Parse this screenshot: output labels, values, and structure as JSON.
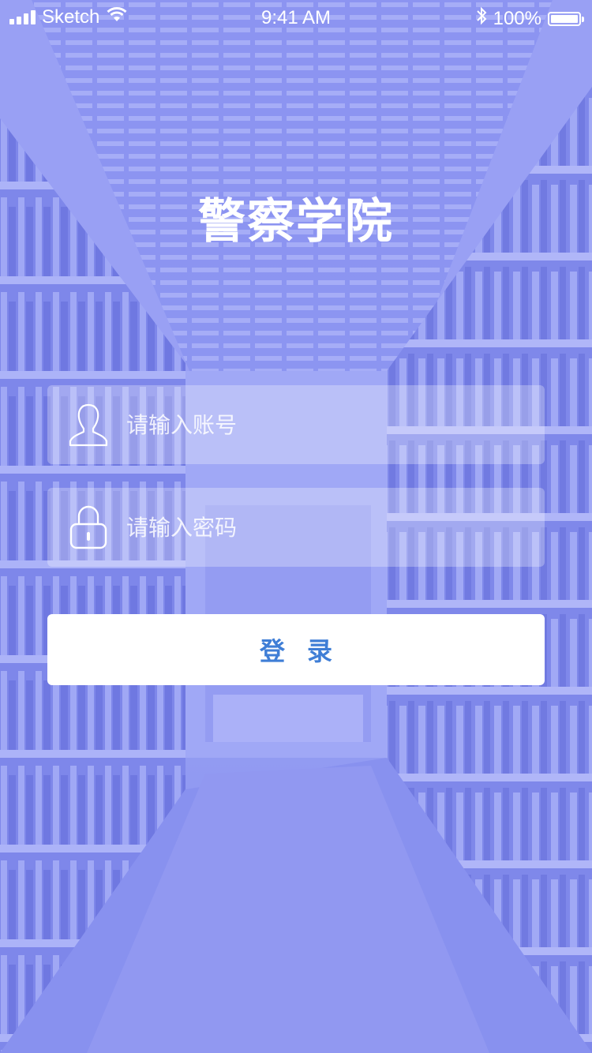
{
  "status_bar": {
    "carrier": "Sketch",
    "time": "9:41 AM",
    "battery_label": "100%",
    "battery_level": 1.0,
    "icons": [
      "signal-icon",
      "wifi-icon",
      "bluetooth-icon",
      "battery-icon"
    ]
  },
  "app": {
    "title": "警察学院"
  },
  "login_form": {
    "account": {
      "placeholder": "请输入账号",
      "value": "",
      "icon": "user-icon"
    },
    "password": {
      "placeholder": "请输入密码",
      "value": "",
      "icon": "lock-icon"
    },
    "submit_label": "登录"
  },
  "colors": {
    "overlay": "#8e96f2",
    "button_text": "#3f7ed6",
    "button_bg": "#ffffff",
    "text": "#ffffff"
  }
}
